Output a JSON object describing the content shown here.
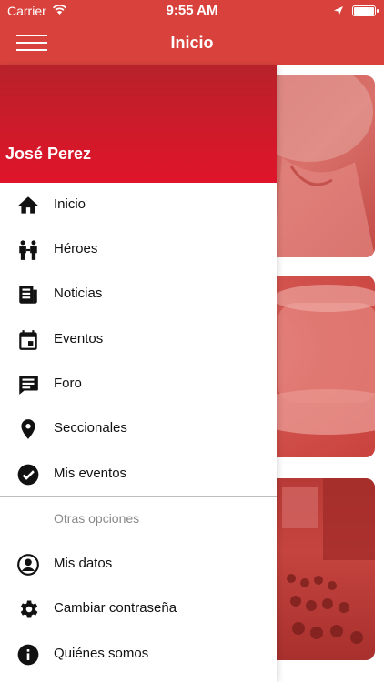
{
  "statusbar": {
    "carrier": "Carrier",
    "time": "9:55 AM"
  },
  "navbar": {
    "title": "Inicio"
  },
  "drawer": {
    "user_name": "José Perez",
    "items": [
      {
        "label": "Inicio",
        "icon": "home-icon"
      },
      {
        "label": "Héroes",
        "icon": "people-icon"
      },
      {
        "label": "Noticias",
        "icon": "newspaper-icon"
      },
      {
        "label": "Eventos",
        "icon": "calendar-icon"
      },
      {
        "label": "Foro",
        "icon": "forum-icon"
      },
      {
        "label": "Seccionales",
        "icon": "location-pin-icon"
      },
      {
        "label": "Mis eventos",
        "icon": "check-circle-icon"
      }
    ],
    "section_title": "Otras opciones",
    "other_items": [
      {
        "label": "Mis datos",
        "icon": "account-circle-icon"
      },
      {
        "label": "Cambiar contraseña",
        "icon": "settings-icon"
      },
      {
        "label": "Quiénes somos",
        "icon": "info-icon"
      }
    ]
  },
  "colors": {
    "brand": "#d9423c",
    "drawer_header_top": "#b8222a",
    "drawer_header_bottom": "#e0142a"
  }
}
